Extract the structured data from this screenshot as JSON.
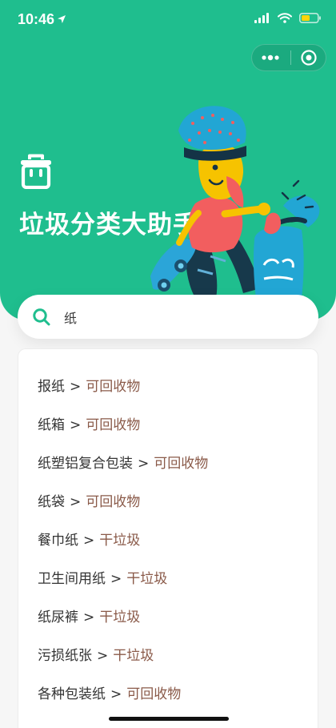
{
  "status_bar": {
    "time": "10:46"
  },
  "header": {
    "title": "垃圾分类大助手"
  },
  "search": {
    "value": "纸"
  },
  "results": [
    {
      "name": "报纸",
      "category": "可回收物"
    },
    {
      "name": "纸箱",
      "category": "可回收物"
    },
    {
      "name": "纸塑铝复合包装",
      "category": "可回收物"
    },
    {
      "name": "纸袋",
      "category": "可回收物"
    },
    {
      "name": "餐巾纸",
      "category": "干垃圾"
    },
    {
      "name": "卫生间用纸",
      "category": "干垃圾"
    },
    {
      "name": "纸尿裤",
      "category": "干垃圾"
    },
    {
      "name": "污损纸张",
      "category": "干垃圾"
    },
    {
      "name": "各种包装纸",
      "category": "可回收物"
    }
  ],
  "colors": {
    "brand_green": "#1fbe8e",
    "category_text": "#8a5a49"
  }
}
